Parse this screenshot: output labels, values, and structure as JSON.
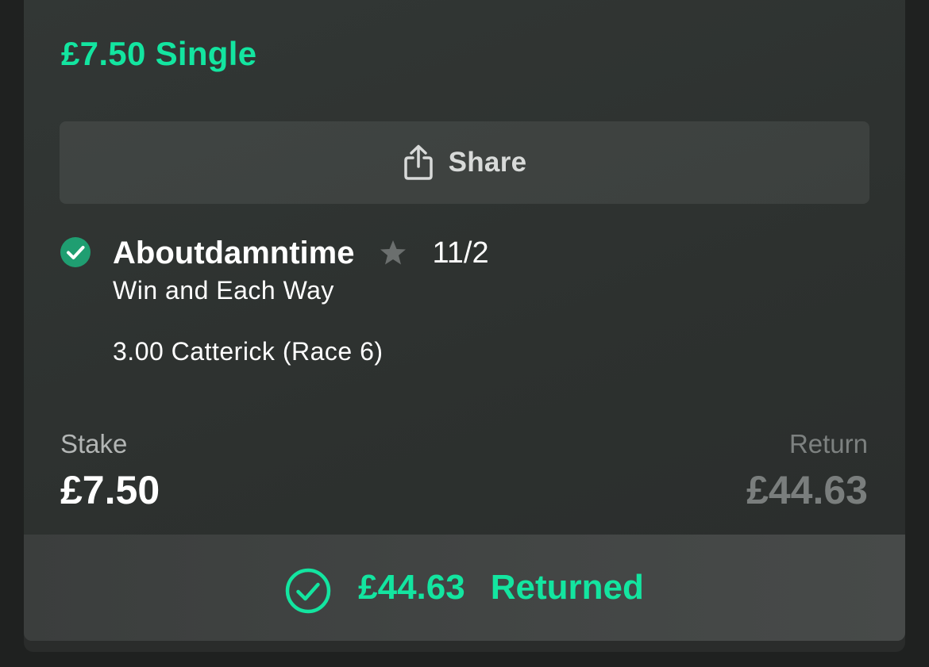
{
  "bet": {
    "title": "£7.50 Single",
    "share_label": "Share",
    "selection": {
      "name": "Aboutdamntime",
      "odds": "11/2",
      "market": "Win and Each Way",
      "event": "3.00 Catterick (Race 6)",
      "status_icon": "check-circle-icon",
      "favourite_icon": "star-icon"
    },
    "stake_label": "Stake",
    "stake_value": "£7.50",
    "return_label": "Return",
    "return_value": "£44.63",
    "returned_amount": "£44.63",
    "returned_label": "Returned"
  },
  "colors": {
    "accent": "#13e5a0",
    "win_check": "#1f9e71",
    "card_background": "#303533",
    "muted_text": "#7a7e7d"
  }
}
